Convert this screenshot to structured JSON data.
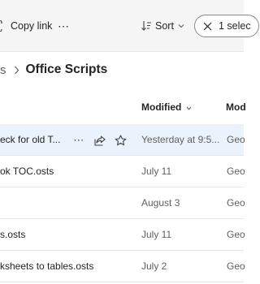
{
  "toolbar": {
    "copy_link_label": "Copy link",
    "more_label": "⋯",
    "sort_label": "Sort",
    "selected_label": "1 selec"
  },
  "breadcrumb": {
    "previous": "s",
    "separator": ">",
    "current": "Office Scripts"
  },
  "columns": {
    "modified": "Modified",
    "modified_by": "Mod"
  },
  "rows": [
    {
      "name": "eck for old T...",
      "modified": "Yesterday at 9:5...",
      "modified_by": "Geo",
      "selected": true
    },
    {
      "name": "ok TOC.osts",
      "modified": "July 11",
      "modified_by": "Geo",
      "selected": false
    },
    {
      "name": "",
      "modified": "August 3",
      "modified_by": "Geo",
      "selected": false
    },
    {
      "name": "s.osts",
      "modified": "July 11",
      "modified_by": "Geo",
      "selected": false
    },
    {
      "name": "ksheets to tables.osts",
      "modified": "July 2",
      "modified_by": "Geo",
      "selected": false
    }
  ],
  "row_actions": {
    "more_label": "⋯"
  },
  "colors": {
    "selected_row_bg": "#eaf2fb",
    "toolbar_bg": "#f5f5f5",
    "divider": "#e6e6e6",
    "text_secondary": "#616161"
  },
  "icons": [
    "link-icon",
    "more-icon",
    "sort-icon",
    "chevron-down-icon",
    "close-icon",
    "chevron-right-icon",
    "share-icon",
    "star-icon"
  ]
}
